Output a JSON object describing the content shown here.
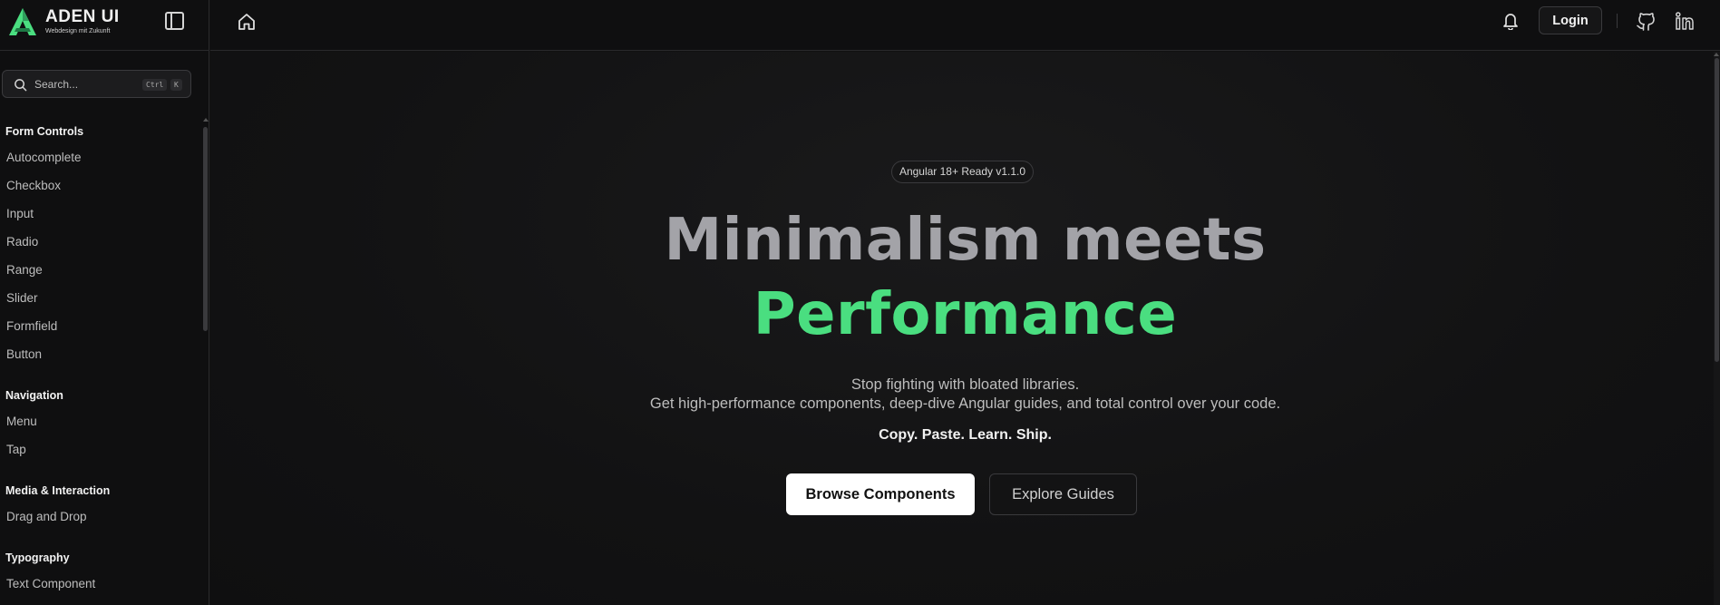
{
  "brand": {
    "name": "ADEN UI",
    "tagline": "Webdesign mit Zukunft",
    "accent": "#4ade80"
  },
  "search": {
    "placeholder": "Search...",
    "shortcut_ctrl": "Ctrl",
    "shortcut_key": "K"
  },
  "sidebar": {
    "groups": [
      {
        "title": "Form Controls",
        "items": [
          "Autocomplete",
          "Checkbox",
          "Input",
          "Radio",
          "Range",
          "Slider",
          "Formfield",
          "Button"
        ]
      },
      {
        "title": "Navigation",
        "items": [
          "Menu",
          "Tap"
        ]
      },
      {
        "title": "Media & Interaction",
        "items": [
          "Drag and Drop"
        ]
      },
      {
        "title": "Typography",
        "items": [
          "Text Component"
        ]
      }
    ]
  },
  "topbar": {
    "login_label": "Login",
    "icons": [
      "home-icon",
      "bell-icon",
      "github-icon",
      "linkedin-icon"
    ]
  },
  "hero": {
    "badge": "Angular 18+ Ready v1.1.0",
    "title_line1": "Minimalism meets",
    "title_line2": "Performance",
    "subtitle_line1": "Stop fighting with bloated libraries.",
    "subtitle_line2": "Get high-performance components, deep-dive Angular guides, and total control over your code.",
    "tagline": "Copy. Paste. Learn. Ship.",
    "primary_button": "Browse Components",
    "secondary_button": "Explore Guides"
  }
}
